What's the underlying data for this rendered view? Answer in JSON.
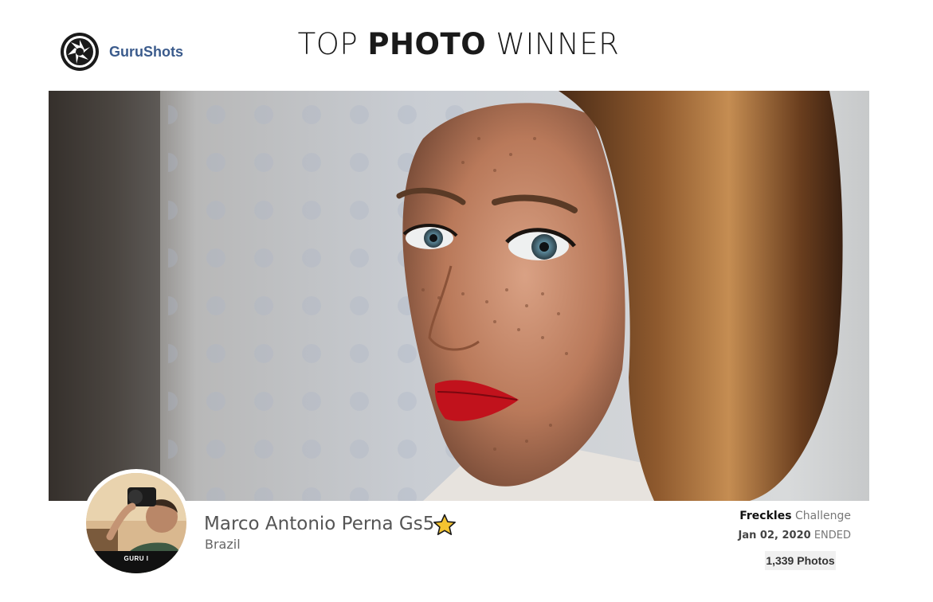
{
  "brand": {
    "name": "GuruShots",
    "icon": "camera-aperture-icon",
    "color": "#3b5b8c"
  },
  "headline": {
    "part1": "TOP",
    "part2": "PHOTO",
    "part3": "WINNER"
  },
  "photo": {
    "subject": "winning-photo"
  },
  "winner": {
    "name": "Marco Antonio Perna Gs5",
    "country": "Brazil",
    "level_badge": "GURU I",
    "icon": "star-icon"
  },
  "challenge": {
    "name": "Freckles",
    "suffix": "Challenge",
    "date": "Jan 02, 2020",
    "status": "ENDED",
    "photo_count": "1,339 Photos"
  }
}
